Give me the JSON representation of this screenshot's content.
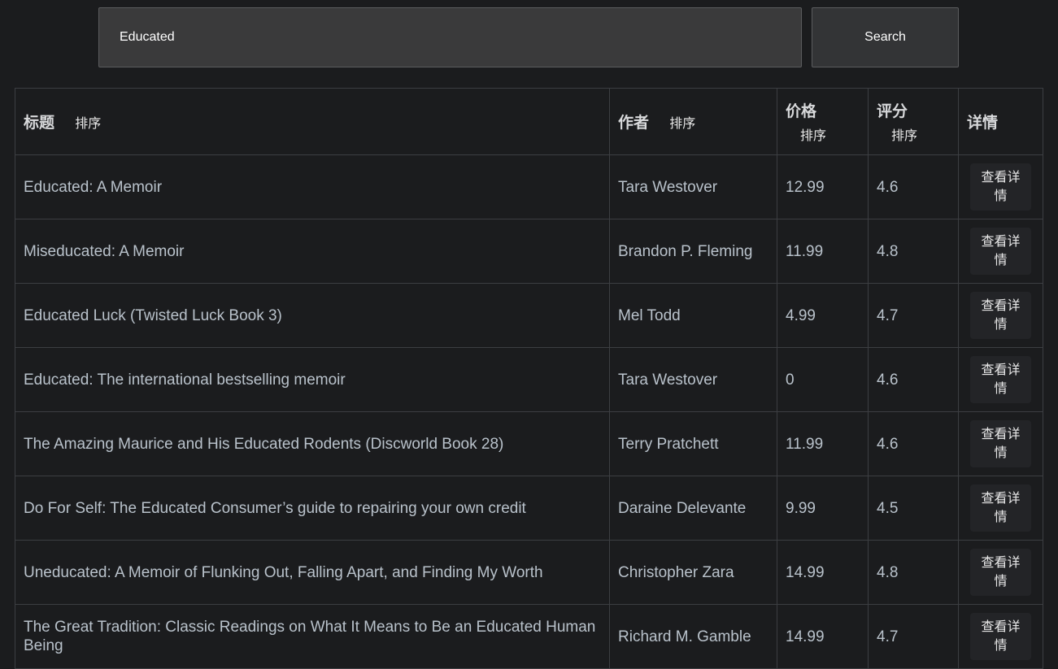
{
  "search": {
    "value": "Educated",
    "button_label": "Search"
  },
  "table": {
    "headers": {
      "title": "标题",
      "author": "作者",
      "price": "价格",
      "rating": "评分",
      "detail": "详情",
      "sort_label": "排序"
    },
    "detail_button_label": "查看详情",
    "rows": [
      {
        "title": "Educated: A Memoir",
        "author": "Tara Westover",
        "price": "12.99",
        "rating": "4.6"
      },
      {
        "title": "Miseducated: A Memoir",
        "author": "Brandon P. Fleming",
        "price": "11.99",
        "rating": "4.8"
      },
      {
        "title": "Educated Luck (Twisted Luck Book 3)",
        "author": "Mel Todd",
        "price": "4.99",
        "rating": "4.7"
      },
      {
        "title": "Educated: The international bestselling memoir",
        "author": "Tara Westover",
        "price": "0",
        "rating": "4.6"
      },
      {
        "title": "The Amazing Maurice and His Educated Rodents (Discworld Book 28)",
        "author": "Terry Pratchett",
        "price": "11.99",
        "rating": "4.6"
      },
      {
        "title": "Do For Self: The Educated Consumer’s guide to repairing your own credit",
        "author": "Daraine Delevante",
        "price": "9.99",
        "rating": "4.5"
      },
      {
        "title": "Uneducated: A Memoir of Flunking Out, Falling Apart, and Finding My Worth",
        "author": "Christopher Zara",
        "price": "14.99",
        "rating": "4.8"
      },
      {
        "title": "The Great Tradition: Classic Readings on What It Means to Be an Educated Human Being",
        "author": "Richard M. Gamble",
        "price": "14.99",
        "rating": "4.7"
      }
    ]
  }
}
